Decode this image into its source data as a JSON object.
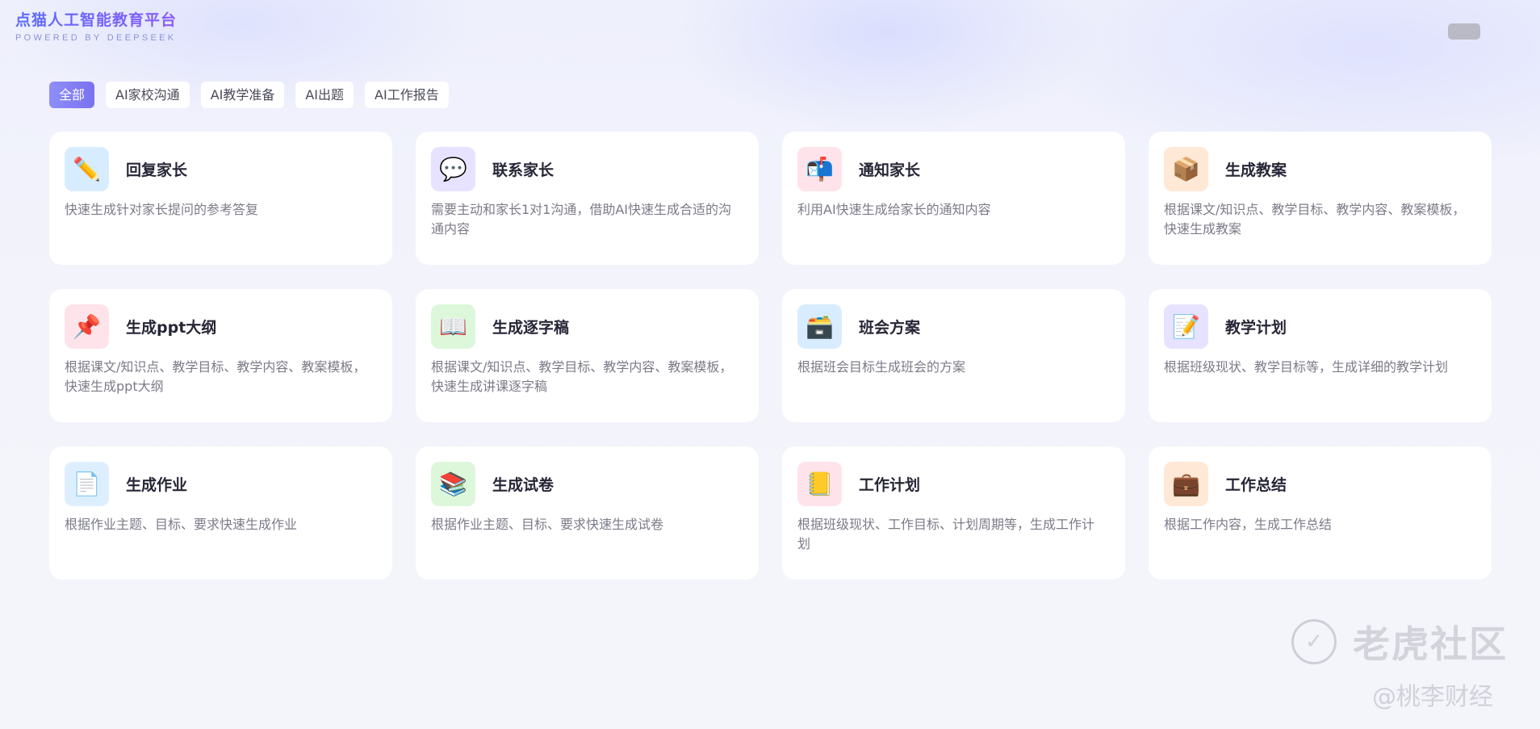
{
  "brand": {
    "title": "点猫人工智能教育平台",
    "subtitle": "POWERED BY DEEPSEEK"
  },
  "tabs": [
    {
      "label": "全部",
      "active": true
    },
    {
      "label": "AI家校沟通",
      "active": false
    },
    {
      "label": "AI教学准备",
      "active": false
    },
    {
      "label": "AI出题",
      "active": false
    },
    {
      "label": "AI工作报告",
      "active": false
    }
  ],
  "cards": [
    {
      "title": "回复家长",
      "desc": "快速生成针对家长提问的参考答复",
      "icon": "pencil-icon",
      "glyph": "✏️"
    },
    {
      "title": "联系家长",
      "desc": "需要主动和家长1对1沟通，借助AI快速生成合适的沟通内容",
      "icon": "speech-bubble-icon",
      "glyph": "💬"
    },
    {
      "title": "通知家长",
      "desc": "利用AI快速生成给家长的通知内容",
      "icon": "mailbox-icon",
      "glyph": "📬"
    },
    {
      "title": "生成教案",
      "desc": "根据课文/知识点、教学目标、教学内容、教案模板，快速生成教案",
      "icon": "box-icon",
      "glyph": "📦"
    },
    {
      "title": "生成ppt大纲",
      "desc": "根据课文/知识点、教学目标、教学内容、教案模板，快速生成ppt大纲",
      "icon": "pushpin-icon",
      "glyph": "📌"
    },
    {
      "title": "生成逐字稿",
      "desc": "根据课文/知识点、教学目标、教学内容、教案模板，快速生成讲课逐字稿",
      "icon": "open-book-icon",
      "glyph": "📖"
    },
    {
      "title": "班会方案",
      "desc": "根据班会目标生成班会的方案",
      "icon": "file-cabinet-icon",
      "glyph": "🗃️"
    },
    {
      "title": "教学计划",
      "desc": "根据班级现状、教学目标等，生成详细的教学计划",
      "icon": "memo-icon",
      "glyph": "📝"
    },
    {
      "title": "生成作业",
      "desc": "根据作业主题、目标、要求快速生成作业",
      "icon": "document-icon",
      "glyph": "📄"
    },
    {
      "title": "生成试卷",
      "desc": "根据作业主题、目标、要求快速生成试卷",
      "icon": "books-icon",
      "glyph": "📚"
    },
    {
      "title": "工作计划",
      "desc": "根据班级现状、工作目标、计划周期等，生成工作计划",
      "icon": "notebook-icon",
      "glyph": "📒"
    },
    {
      "title": "工作总结",
      "desc": "根据工作内容，生成工作总结",
      "icon": "briefcase-icon",
      "glyph": "💼"
    }
  ],
  "watermark": {
    "main": "老虎社区",
    "sub": "@桃李财经"
  }
}
